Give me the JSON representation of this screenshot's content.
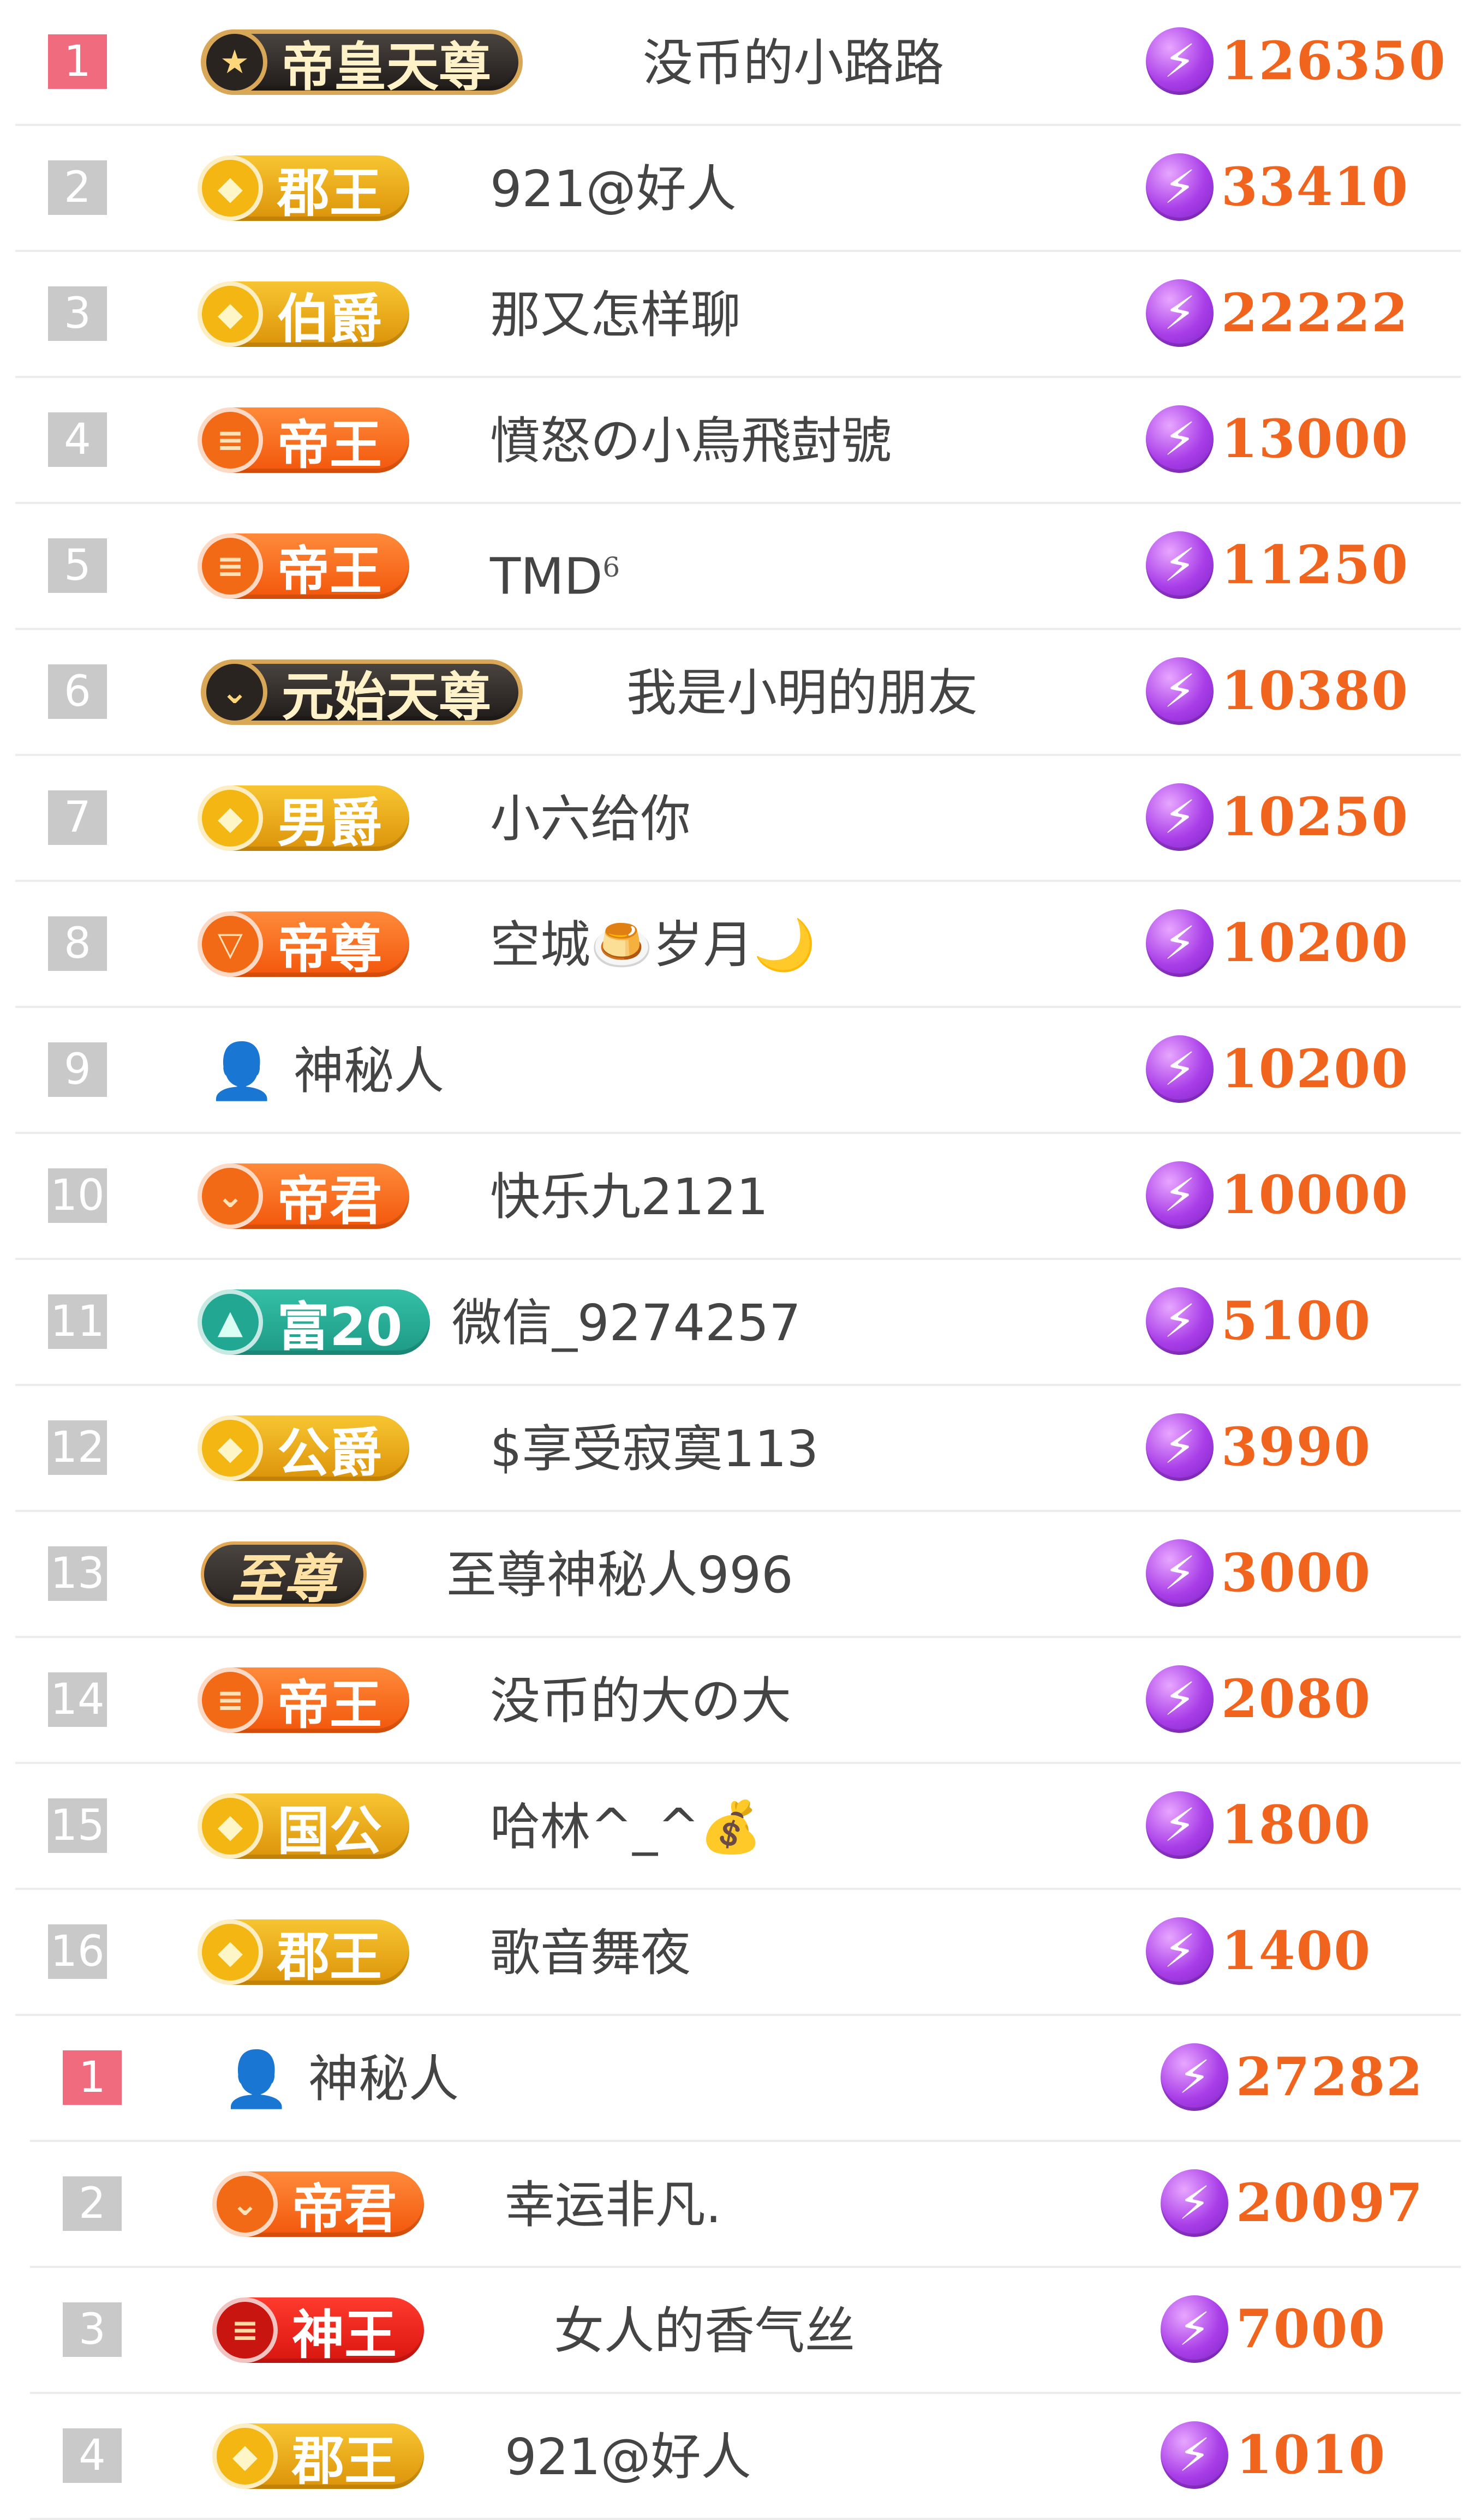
{
  "colors": {
    "rank_top": "#f06b7d",
    "rank_default": "#c9c9c9",
    "score": "#f0641e",
    "coin": "#a93ee8"
  },
  "coin_icon": "lightning-coin-icon",
  "sections": [
    {
      "rows": [
        {
          "rank": "1",
          "top": true,
          "badge_style": "dark",
          "medal": "★",
          "badge": "帝皇天尊",
          "name": "没币的小路路",
          "score": "126350"
        },
        {
          "rank": "2",
          "top": false,
          "badge_style": "gold",
          "medal": "◆",
          "badge": "郡王",
          "name": "921@好人",
          "score": "33410"
        },
        {
          "rank": "3",
          "top": false,
          "badge_style": "gold",
          "medal": "◆",
          "badge": "伯爵",
          "name": "那又怎样聊",
          "score": "22222"
        },
        {
          "rank": "4",
          "top": false,
          "badge_style": "orange",
          "medal": "≡",
          "badge": "帝王",
          "name": "憤怒の小鳥飛尌號",
          "score": "13000"
        },
        {
          "rank": "5",
          "top": false,
          "badge_style": "orange",
          "medal": "≡",
          "badge": "帝王",
          "name": "TMD",
          "name_sup": "6",
          "score": "11250"
        },
        {
          "rank": "6",
          "top": false,
          "badge_style": "dark",
          "medal": "⌄",
          "badge": "元始天尊",
          "name": "我是小明的朋友",
          "score": "10380"
        },
        {
          "rank": "7",
          "top": false,
          "badge_style": "gold",
          "medal": "◆",
          "badge": "男爵",
          "name": "小六给你",
          "score": "10250"
        },
        {
          "rank": "8",
          "top": false,
          "badge_style": "orange",
          "medal": "▽",
          "badge": "帝尊",
          "name": "空城🍮岁月🌙",
          "score": "10200"
        },
        {
          "rank": "9",
          "top": false,
          "badge_style": "mystery",
          "medal": "",
          "badge": "",
          "name": "神秘人",
          "score": "10200"
        },
        {
          "rank": "10",
          "top": false,
          "badge_style": "orange",
          "medal": "⌄",
          "badge": "帝君",
          "name": "快乐九2121",
          "score": "10000"
        },
        {
          "rank": "11",
          "top": false,
          "badge_style": "teal",
          "medal": "▲",
          "badge": "富20",
          "name": "微信_9274257",
          "score": "5100"
        },
        {
          "rank": "12",
          "top": false,
          "badge_style": "gold",
          "medal": "◆",
          "badge": "公爵",
          "name": "$享受寂寞113",
          "score": "3990"
        },
        {
          "rank": "13",
          "top": false,
          "badge_style": "slate",
          "medal": "",
          "badge": "至尊",
          "name": "至尊神秘人996",
          "score": "3000"
        },
        {
          "rank": "14",
          "top": false,
          "badge_style": "orange",
          "medal": "≡",
          "badge": "帝王",
          "name": "没币的大の大",
          "score": "2080"
        },
        {
          "rank": "15",
          "top": false,
          "badge_style": "gold",
          "medal": "◆",
          "badge": "国公",
          "name": "哈林^_^💰",
          "score": "1800"
        },
        {
          "rank": "16",
          "top": false,
          "badge_style": "gold",
          "medal": "◆",
          "badge": "郡王",
          "name": "歌音舞夜",
          "score": "1400"
        }
      ]
    },
    {
      "rows": [
        {
          "rank": "1",
          "top": true,
          "badge_style": "mystery",
          "medal": "",
          "badge": "",
          "name": "神秘人",
          "score": "27282"
        },
        {
          "rank": "2",
          "top": false,
          "badge_style": "orange",
          "medal": "⌄",
          "badge": "帝君",
          "name": "幸运非凡.",
          "score": "20097"
        },
        {
          "rank": "3",
          "top": false,
          "badge_style": "red",
          "medal": "≡",
          "badge": "神王",
          "name": "女人的香气丝",
          "score": "7000"
        },
        {
          "rank": "4",
          "top": false,
          "badge_style": "gold",
          "medal": "◆",
          "badge": "郡王",
          "name": "921@好人",
          "score": "1010"
        }
      ]
    }
  ]
}
